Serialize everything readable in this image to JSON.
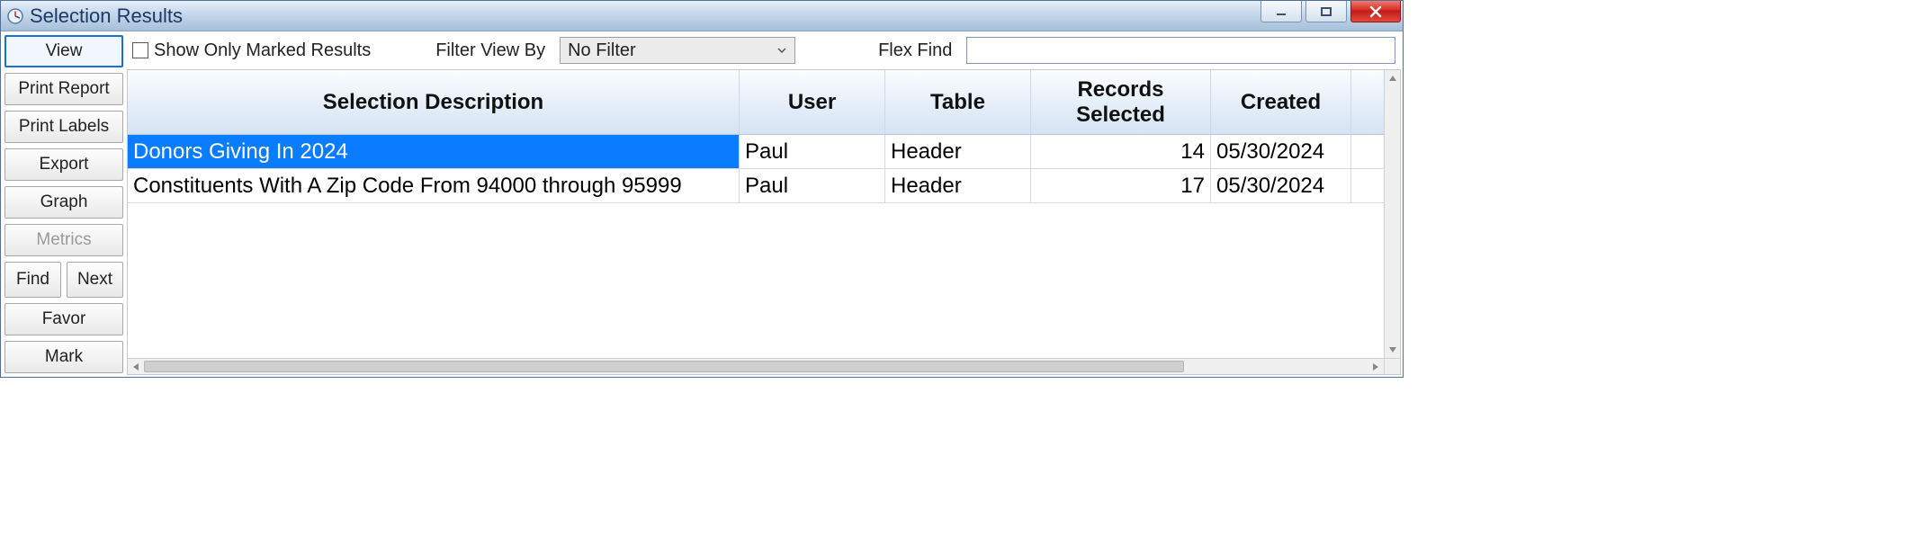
{
  "window": {
    "title": "Selection Results"
  },
  "sidebar": {
    "view": "View",
    "print_report": "Print Report",
    "print_labels": "Print Labels",
    "export": "Export",
    "graph": "Graph",
    "metrics": "Metrics",
    "find": "Find",
    "next": "Next",
    "favor": "Favor",
    "mark": "Mark"
  },
  "toolbar": {
    "show_only_marked": "Show Only Marked Results",
    "filter_label": "Filter View By",
    "filter_value": "No Filter",
    "flex_find_label": "Flex Find",
    "flex_find_value": ""
  },
  "table": {
    "headers": {
      "description": "Selection Description",
      "user": "User",
      "table": "Table",
      "records": "Records Selected",
      "created": "Created"
    },
    "rows": [
      {
        "description": "Donors Giving In 2024",
        "user": "Paul",
        "table": "Header",
        "records": "14",
        "created": "05/30/2024",
        "selected": true
      },
      {
        "description": "Constituents With A Zip Code From 94000 through 95999",
        "user": "Paul",
        "table": "Header",
        "records": "17",
        "created": "05/30/2024",
        "selected": false
      }
    ]
  }
}
